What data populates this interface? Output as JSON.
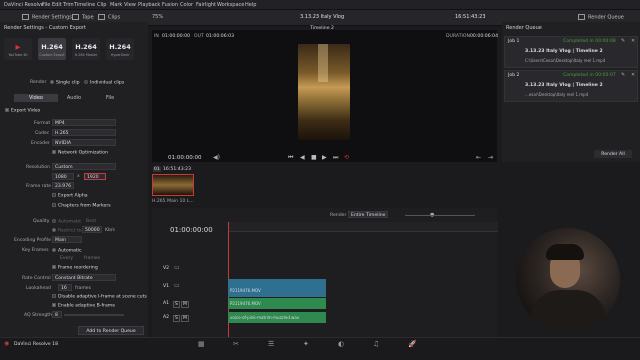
{
  "menubar": {
    "items": [
      "DaVinci Resolve",
      "File",
      "Edit",
      "Trim",
      "Timeline",
      "Clip",
      "Mark",
      "View",
      "Playback",
      "Fusion",
      "Color",
      "Fairlight",
      "Workspace",
      "Help"
    ],
    "project_title": "3.13.23 Italy Vlog",
    "edited": "Edited"
  },
  "toolbar": {
    "render_settings": "Render Settings",
    "tape": "Tape",
    "clips": "Clips",
    "zoom": "75%",
    "title": "3.13.23 Italy Vlog",
    "timecode": "16:51:43:23",
    "render_queue": "Render Queue"
  },
  "left_panel": {
    "title": "Render Settings - Custom Export",
    "presets": [
      {
        "big": "▶",
        "small": "YouTube 4K"
      },
      {
        "big": "H.264",
        "small": "Custom Export"
      },
      {
        "big": "H.264",
        "small": "H.264 Master"
      },
      {
        "big": "H.264",
        "small": "HyperDeck"
      }
    ],
    "render_label": "Render",
    "single_clip": "Single clip",
    "individual_clips": "Individual clips",
    "tabs": [
      "Video",
      "Audio",
      "File"
    ],
    "export_video": "Export Video",
    "rows": {
      "format": {
        "label": "Format",
        "value": "MP4"
      },
      "codec": {
        "label": "Codec",
        "value": "H.265"
      },
      "encoder": {
        "label": "Encoder",
        "value": "NVIDIA"
      },
      "network_opt": "Network Optimization",
      "resolution": {
        "label": "Resolution",
        "value": "Custom"
      },
      "res_w": "1080",
      "res_x": "x",
      "res_h": "1920",
      "frame_rate": {
        "label": "Frame rate",
        "value": "23.976"
      },
      "export_alpha": "Export Alpha",
      "chapters": "Chapters from Markers",
      "quality": {
        "label": "Quality",
        "auto": "Automatic",
        "best": "Best"
      },
      "restrict_to": "Restrict to",
      "restrict_value": "50000",
      "kbs": "Kb/s",
      "encoding_profile": {
        "label": "Encoding Profile",
        "value": "Main"
      },
      "key_frames": {
        "label": "Key Frames",
        "auto": "Automatic",
        "every": "Every",
        "frames": "frames"
      },
      "frame_reorder": "Frame reordering",
      "rate_control": {
        "label": "Rate Control",
        "value": "Constant Bitrate"
      },
      "lookahead": {
        "label": "Lookahead",
        "value": "16",
        "unit": "frames"
      },
      "disable_adaptive_i": "Disable adaptive I-frame at scene cuts",
      "enable_adaptive_b": "Enable adaptive B-frame",
      "aq_strength": {
        "label": "AQ Strength",
        "value": "8"
      }
    },
    "add_button": "Add to Render Queue"
  },
  "viewer": {
    "timeline_name": "Timeline 2",
    "in_label": "IN",
    "in_tc": "01:00:00:00",
    "out_label": "OUT",
    "out_tc": "01:00:06:03",
    "duration_label": "DURATION",
    "duration_tc": "00:00:06:04",
    "play_tc": "01:00:00:00",
    "clip_tc": "16:51:43:23",
    "clip_num": "01",
    "clip_name": "H.265 Main 10 L..."
  },
  "timeline": {
    "render_label": "Render",
    "render_value": "Entire Timeline",
    "tc": "01:00:00:00",
    "tracks": [
      {
        "name": "V2",
        "clip": ""
      },
      {
        "name": "V1",
        "clip": "P2119476.MOV"
      },
      {
        "name": "A1",
        "clip": "P2119476.MOV"
      },
      {
        "name": "A2",
        "clip": "voice-of-pink-matrim-muzzled.wav"
      }
    ],
    "track_buttons": [
      "S",
      "M"
    ]
  },
  "render_queue": {
    "title": "Render Queue",
    "jobs": [
      {
        "job": "Job 1",
        "status": "Completed in 00:00:08",
        "name": "3.13.23 Italy Vlog | Timeline 2",
        "path": "C:\\Users\\Cesar\\Desktop\\Italy reel 1.mp4"
      },
      {
        "job": "Job 2",
        "status": "Completed in 00:00:07",
        "name": "3.13.23 Italy Vlog | Timeline 2",
        "path": "...esar\\Desktop\\Italy reel 1.mp4"
      }
    ],
    "render_all": "Render All"
  },
  "bottom": {
    "app": "DaVinci Resolve 18"
  },
  "colors": {
    "accent_red": "#c63a3a",
    "track_blue": "#2f6f8f",
    "audio_green": "#2f8a4f",
    "completed_green": "#4c9a3c"
  }
}
